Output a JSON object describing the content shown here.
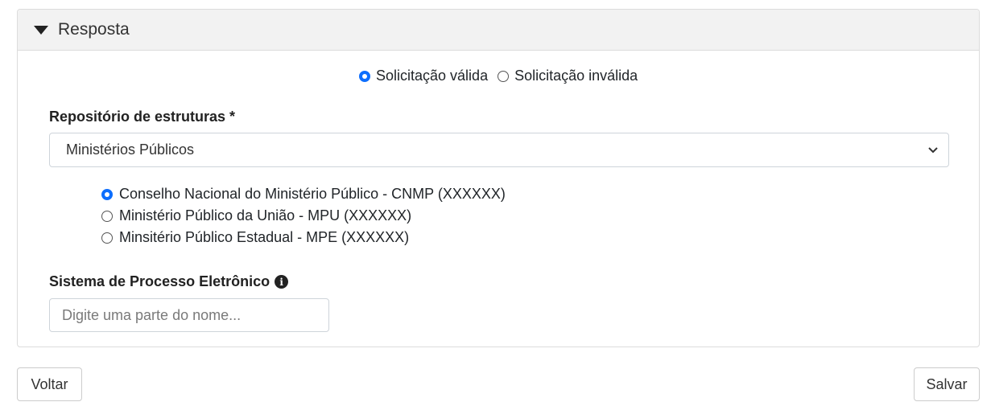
{
  "panel": {
    "title": "Resposta"
  },
  "validity": {
    "options": [
      {
        "label": "Solicitação válida",
        "checked": true
      },
      {
        "label": "Solicitação inválida",
        "checked": false
      }
    ]
  },
  "repository": {
    "label": "Repositório de estruturas *",
    "selected": "Ministérios Públicos"
  },
  "organizations": [
    {
      "label": "Conselho Nacional do Ministério Público - CNMP (XXXXXX)",
      "checked": true
    },
    {
      "label": "Ministério Público da União - MPU (XXXXXX)",
      "checked": false
    },
    {
      "label": "Minsitério Público Estadual - MPE (XXXXXX)",
      "checked": false
    }
  ],
  "system": {
    "label": "Sistema de Processo Eletrônico",
    "placeholder": "Digite uma parte do nome..."
  },
  "actions": {
    "back": "Voltar",
    "save": "Salvar"
  },
  "colors": {
    "accent": "#0d6efd"
  }
}
